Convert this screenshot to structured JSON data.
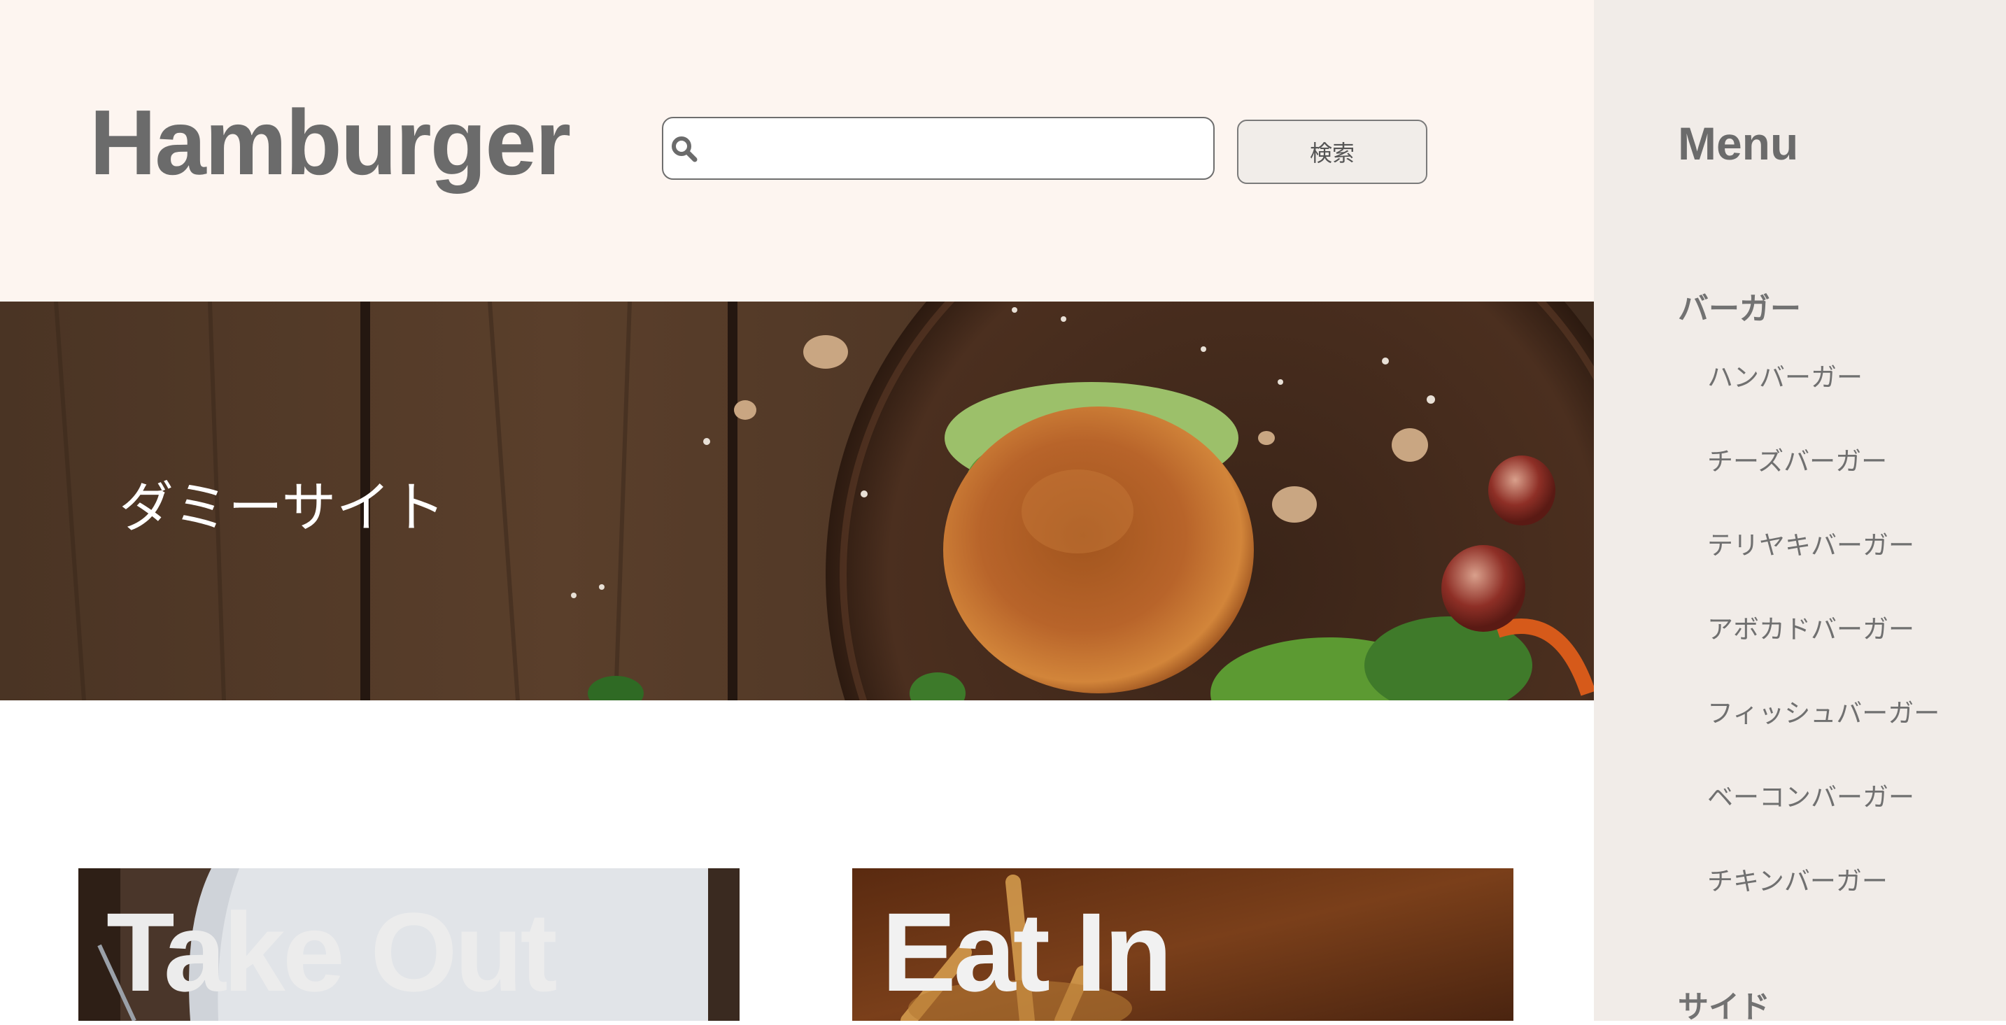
{
  "header": {
    "title": "Hamburger",
    "search_placeholder": "",
    "search_value": "",
    "search_button": "検索",
    "search_icon": "search-icon"
  },
  "hero": {
    "caption": "ダミーサイト"
  },
  "cards": [
    {
      "label": "Take Out"
    },
    {
      "label": "Eat In"
    }
  ],
  "sidebar": {
    "heading": "Menu",
    "categories": [
      {
        "label": "バーガー",
        "items": [
          "ハンバーガー",
          "チーズバーガー",
          "テリヤキバーガー",
          "アボカドバーガー",
          "フィッシュバーガー",
          "ベーコンバーガー",
          "チキンバーガー"
        ]
      },
      {
        "label": "サイド",
        "items": []
      }
    ]
  },
  "colors": {
    "header_bg": "#fdf5f0",
    "sidebar_bg": "#f1ece8",
    "text_gray": "#6b6b6b",
    "button_bg": "#f1ede9"
  }
}
